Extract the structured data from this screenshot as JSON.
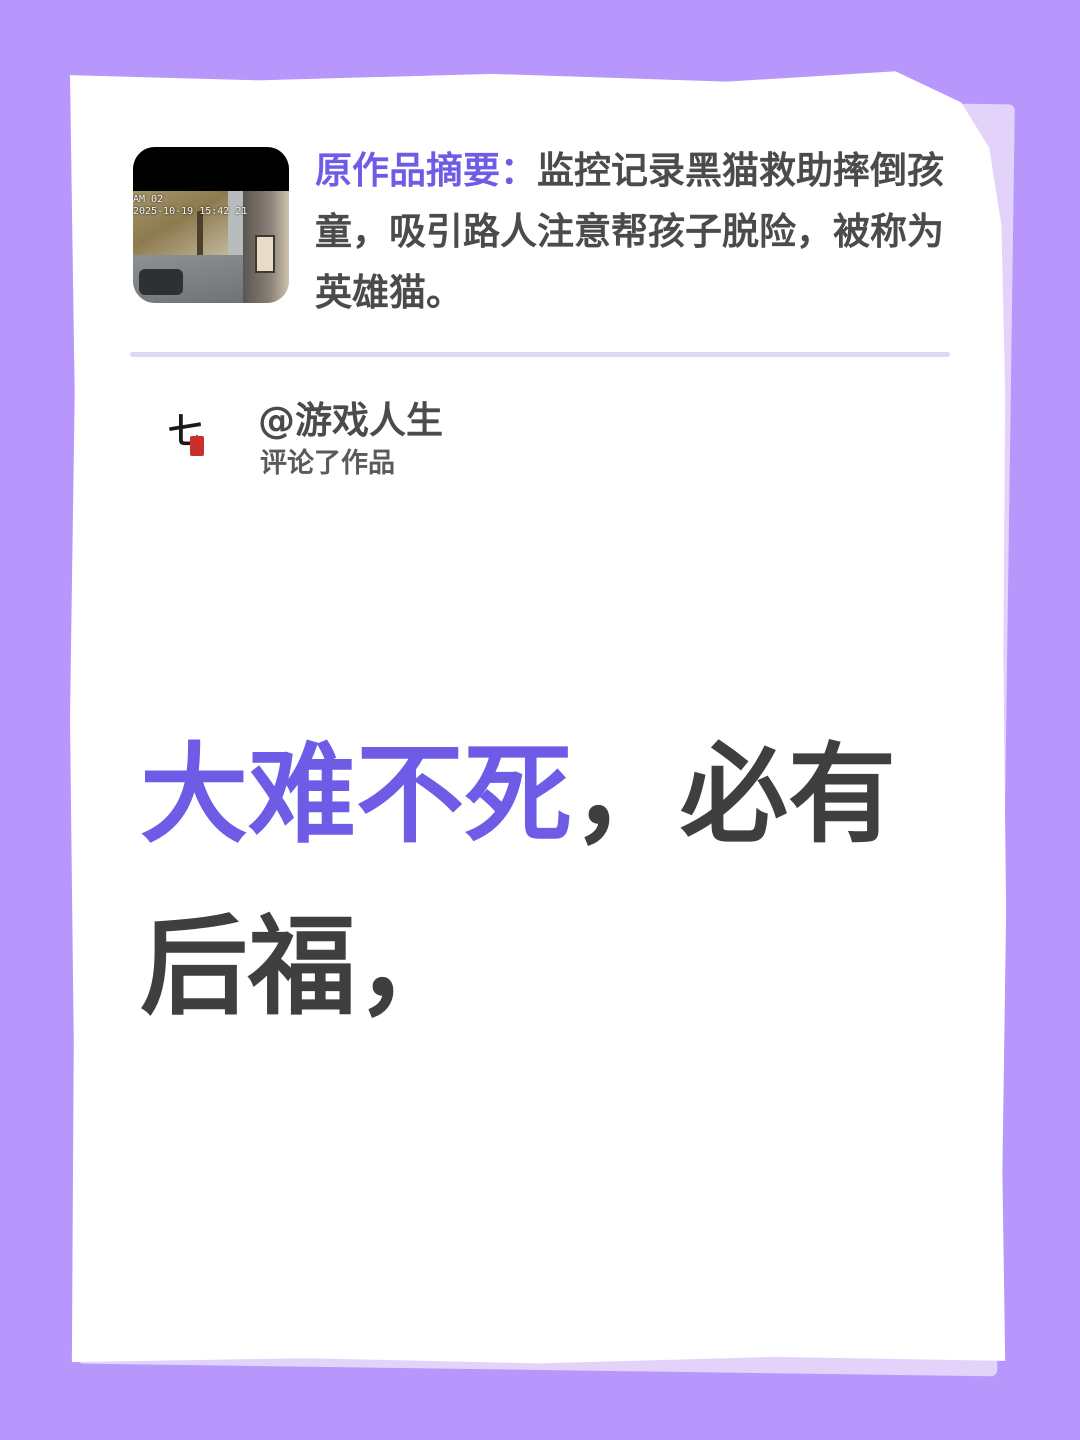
{
  "summary": {
    "label": "原作品摘要：",
    "text": "监控记录黑猫救助摔倒孩童，吸引路人注意帮孩子脱险，被称为英雄猫。"
  },
  "thumbnail": {
    "overlay_line1": "AM 02",
    "overlay_line2": "2025-10-19 15:42 21"
  },
  "author": {
    "name": "@游戏人生",
    "action": "评论了作品",
    "avatar_glyph": "七"
  },
  "comment": {
    "highlight": "大难不死",
    "rest": "，必有后福，"
  },
  "colors": {
    "background": "#b797fb",
    "accent": "#6e5ce6",
    "text": "#3f3f3f"
  }
}
